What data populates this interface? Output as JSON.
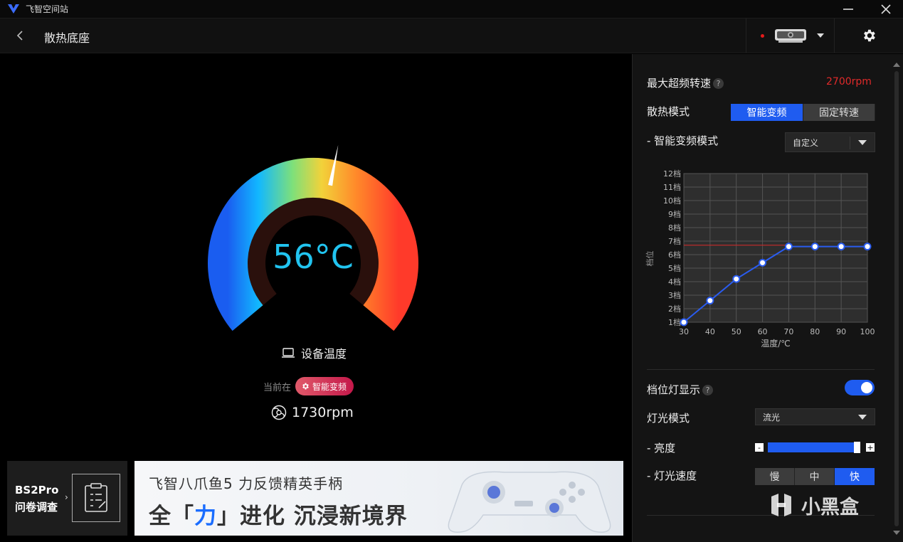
{
  "app": {
    "title": "飞智空间站"
  },
  "header": {
    "page_title": "散热底座"
  },
  "gauge": {
    "temperature": "56°C",
    "label": "设备温度",
    "current_label": "当前在",
    "mode_badge": "智能变频",
    "rpm": "1730rpm"
  },
  "survey": {
    "line1": "BS2Pro",
    "line2": "问卷调查"
  },
  "ad": {
    "line1": "飞智八爪鱼5 力反馈精英手柄",
    "line2_a": "全「",
    "line2_accent": "力",
    "line2_b": "」进化 沉浸新境界"
  },
  "panel": {
    "max_speed_label": "最大超频转速",
    "max_speed_value": "2700rpm",
    "cooling_mode_label": "散热模式",
    "cooling_modes": [
      "智能变频",
      "固定转速"
    ],
    "cooling_mode_selected": "智能变频",
    "smart_mode_label": "- 智能变频模式",
    "smart_mode_value": "自定义",
    "light_display_label": "档位灯显示",
    "light_display_on": true,
    "light_mode_label": "灯光模式",
    "light_mode_value": "流光",
    "brightness_label": "- 亮度",
    "brightness_minus": "-",
    "brightness_plus": "+",
    "brightness_level": 0.97,
    "light_speed_label": "- 灯光速度",
    "light_speeds": [
      "慢",
      "中",
      "快"
    ],
    "light_speed_selected": "快"
  },
  "chart_data": {
    "type": "line",
    "x": [
      30,
      40,
      50,
      60,
      70,
      80,
      90,
      100
    ],
    "y": [
      1,
      2.6,
      4.2,
      5.4,
      6.6,
      6.6,
      6.6,
      6.6
    ],
    "x_ticks": [
      "30",
      "40",
      "50",
      "60",
      "70",
      "80",
      "90",
      "100"
    ],
    "y_ticks": [
      "1档",
      "2档",
      "3档",
      "4档",
      "5档",
      "6档",
      "7档",
      "8档",
      "9档",
      "10档",
      "11档",
      "12档"
    ],
    "xlabel": "温度/℃",
    "ylabel": "档位",
    "xlim": [
      30,
      100
    ],
    "ylim": [
      1,
      12
    ],
    "limit_line": 6.7,
    "grid": true
  },
  "colors": {
    "accent": "#1f5cf0",
    "alert": "#e02a2a",
    "temp_text": "#21c4f0"
  },
  "watermark": {
    "text": "小黑盒"
  }
}
